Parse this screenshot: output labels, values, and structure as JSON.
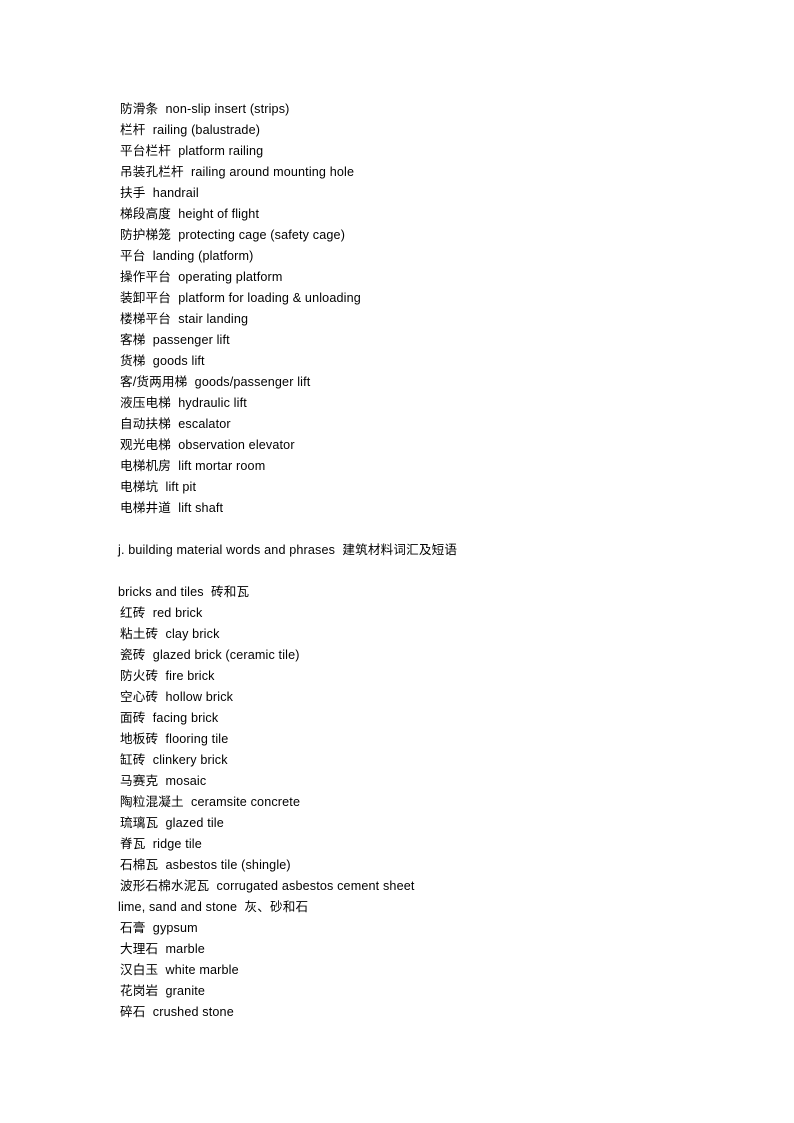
{
  "document": {
    "page_background": "#ffffff",
    "text_color": "#000000",
    "blocks": [
      {
        "type": "entry",
        "indent": 1,
        "text": "防滑条  non-slip insert (strips)"
      },
      {
        "type": "entry",
        "indent": 1,
        "text": "栏杆  railing (balustrade)"
      },
      {
        "type": "entry",
        "indent": 1,
        "text": "平台栏杆  platform railing"
      },
      {
        "type": "entry",
        "indent": 1,
        "text": "吊装孔栏杆  railing around mounting hole"
      },
      {
        "type": "entry",
        "indent": 1,
        "text": "扶手  handrail"
      },
      {
        "type": "entry",
        "indent": 1,
        "text": "梯段高度  height of flight"
      },
      {
        "type": "entry",
        "indent": 1,
        "text": "防护梯笼  protecting cage (safety cage)"
      },
      {
        "type": "entry",
        "indent": 1,
        "text": "平台  landing (platform)"
      },
      {
        "type": "entry",
        "indent": 1,
        "text": "操作平台  operating platform"
      },
      {
        "type": "entry",
        "indent": 1,
        "text": "装卸平台  platform for loading & unloading"
      },
      {
        "type": "entry",
        "indent": 1,
        "text": "楼梯平台  stair landing"
      },
      {
        "type": "entry",
        "indent": 1,
        "text": "客梯  passenger lift"
      },
      {
        "type": "entry",
        "indent": 1,
        "text": "货梯  goods lift"
      },
      {
        "type": "entry",
        "indent": 1,
        "text": "客/货两用梯  goods/passenger lift"
      },
      {
        "type": "entry",
        "indent": 1,
        "text": "液压电梯  hydraulic lift"
      },
      {
        "type": "entry",
        "indent": 1,
        "text": "自动扶梯  escalator"
      },
      {
        "type": "entry",
        "indent": 1,
        "text": "观光电梯  observation elevator"
      },
      {
        "type": "entry",
        "indent": 1,
        "text": "电梯机房  lift mortar room"
      },
      {
        "type": "entry",
        "indent": 1,
        "text": "电梯坑  lift pit"
      },
      {
        "type": "entry",
        "indent": 1,
        "text": "电梯井道  lift shaft"
      },
      {
        "type": "blank",
        "indent": 0,
        "text": ""
      },
      {
        "type": "heading",
        "indent": 0,
        "text": "j. building material words and phrases  建筑材料词汇及短语"
      },
      {
        "type": "blank",
        "indent": 0,
        "text": ""
      },
      {
        "type": "subheading",
        "indent": 0,
        "text": "bricks and tiles  砖和瓦"
      },
      {
        "type": "entry",
        "indent": 1,
        "text": "红砖  red brick"
      },
      {
        "type": "entry",
        "indent": 1,
        "text": "粘土砖  clay brick"
      },
      {
        "type": "entry",
        "indent": 1,
        "text": "瓷砖  glazed brick (ceramic tile)"
      },
      {
        "type": "entry",
        "indent": 1,
        "text": "防火砖  fire brick"
      },
      {
        "type": "entry",
        "indent": 1,
        "text": "空心砖  hollow brick"
      },
      {
        "type": "entry",
        "indent": 1,
        "text": "面砖  facing brick"
      },
      {
        "type": "entry",
        "indent": 1,
        "text": "地板砖  flooring tile"
      },
      {
        "type": "entry",
        "indent": 1,
        "text": "缸砖  clinkery brick"
      },
      {
        "type": "entry",
        "indent": 1,
        "text": "马赛克  mosaic"
      },
      {
        "type": "entry",
        "indent": 1,
        "text": "陶粒混凝土  ceramsite concrete"
      },
      {
        "type": "entry",
        "indent": 1,
        "text": "琉璃瓦  glazed tile"
      },
      {
        "type": "entry",
        "indent": 1,
        "text": "脊瓦  ridge tile"
      },
      {
        "type": "entry",
        "indent": 1,
        "text": "石棉瓦  asbestos tile (shingle)"
      },
      {
        "type": "entry",
        "indent": 1,
        "text": "波形石棉水泥瓦  corrugated asbestos cement sheet"
      },
      {
        "type": "subheading",
        "indent": 0,
        "text": "lime, sand and stone  灰、砂和石"
      },
      {
        "type": "entry",
        "indent": 1,
        "text": "石膏  gypsum"
      },
      {
        "type": "entry",
        "indent": 1,
        "text": "大理石  marble"
      },
      {
        "type": "entry",
        "indent": 1,
        "text": "汉白玉  white marble"
      },
      {
        "type": "entry",
        "indent": 1,
        "text": "花岗岩  granite"
      },
      {
        "type": "entry",
        "indent": 1,
        "text": "碎石  crushed stone"
      }
    ]
  }
}
